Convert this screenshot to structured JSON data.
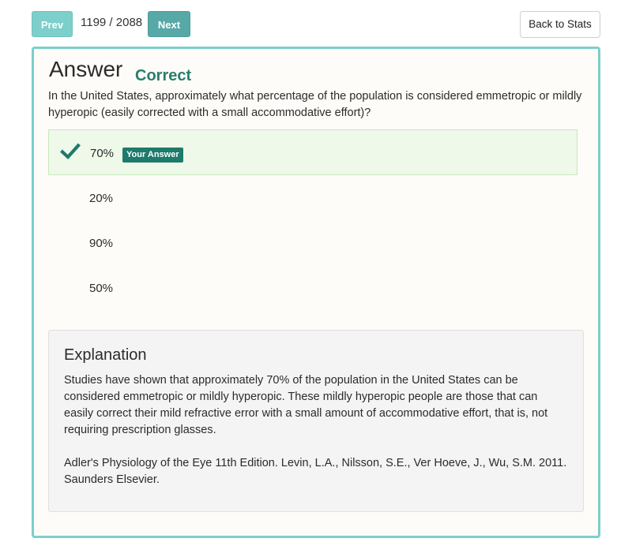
{
  "nav": {
    "prev_label": "Prev",
    "next_label": "Next",
    "counter": "1199 / 2088",
    "back_label": "Back to Stats"
  },
  "answer": {
    "heading": "Answer",
    "status": "Correct",
    "question": "In the United States, approximately what percentage of the population is considered emmetropic or mildly hyperopic (easily corrected with a small accommodative effort)?"
  },
  "options": [
    {
      "text": "70%",
      "badge": "Your Answer",
      "selected": true,
      "icon": "checkmark-icon"
    },
    {
      "text": "20%"
    },
    {
      "text": "90%"
    },
    {
      "text": "50%"
    }
  ],
  "explanation": {
    "title": "Explanation",
    "body": "Studies have shown that approximately 70% of the population in the United States can be considered emmetropic or mildly hyperopic. These mildly hyperopic people are those that can easily correct their mild refractive error with a small amount of accommodative effort, that is, not requiring prescription glasses.",
    "reference": "Adler's Physiology of the Eye 11th Edition. Levin, L.A., Nilsson, S.E., Ver Hoeve, J., Wu, S.M. 2011. Saunders Elsevier."
  },
  "colors": {
    "accent": "#7ccfcb",
    "correct": "#2a7d6b",
    "badge": "#1e7a6b",
    "selected_bg": "#eef9e9"
  }
}
